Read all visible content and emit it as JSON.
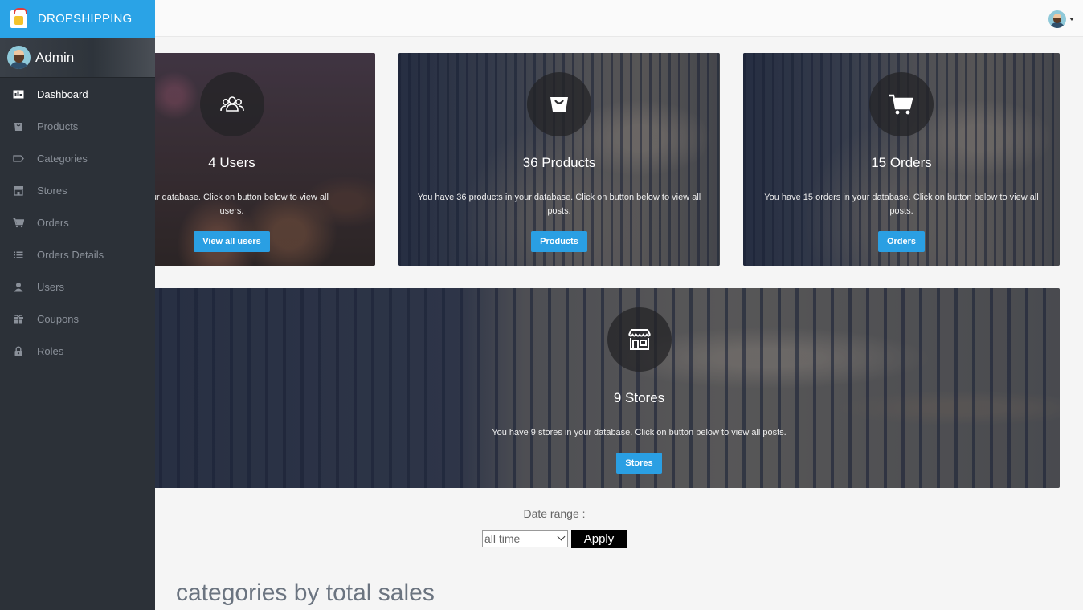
{
  "brand": {
    "name": "DROPSHIPPING"
  },
  "profile": {
    "name": "Admin"
  },
  "sidebar": {
    "items": [
      {
        "label": "Dashboard",
        "icon": "dashboard-icon",
        "active": true
      },
      {
        "label": "Products",
        "icon": "bag-icon"
      },
      {
        "label": "Categories",
        "icon": "tag-icon"
      },
      {
        "label": "Stores",
        "icon": "store-icon"
      },
      {
        "label": "Orders",
        "icon": "cart-icon"
      },
      {
        "label": "Orders Details",
        "icon": "list-icon"
      },
      {
        "label": "Users",
        "icon": "user-icon"
      },
      {
        "label": "Coupons",
        "icon": "gift-icon"
      },
      {
        "label": "Roles",
        "icon": "lock-icon"
      }
    ]
  },
  "cards": {
    "users": {
      "title": "4 Users",
      "text": "n your database. Click on button below to view all users.",
      "button": "View all users"
    },
    "products": {
      "title": "36 Products",
      "text": "You have 36 products in your database. Click on button below to view all posts.",
      "button": "Products"
    },
    "orders": {
      "title": "15 Orders",
      "text": "You have 15 orders in your database. Click on button below to view all posts.",
      "button": "Orders"
    },
    "stores": {
      "title": "9 Stores",
      "text": "You have 9 stores in your database. Click on button below to view all posts.",
      "button": "Stores"
    }
  },
  "date_range": {
    "label": "Date range :",
    "selected": "all time",
    "apply": "Apply"
  },
  "section": {
    "title": "categories by total sales"
  },
  "colors": {
    "accent": "#2aa3e6",
    "sidebar_bg": "#2c3138",
    "button": "#2a9fe3"
  }
}
